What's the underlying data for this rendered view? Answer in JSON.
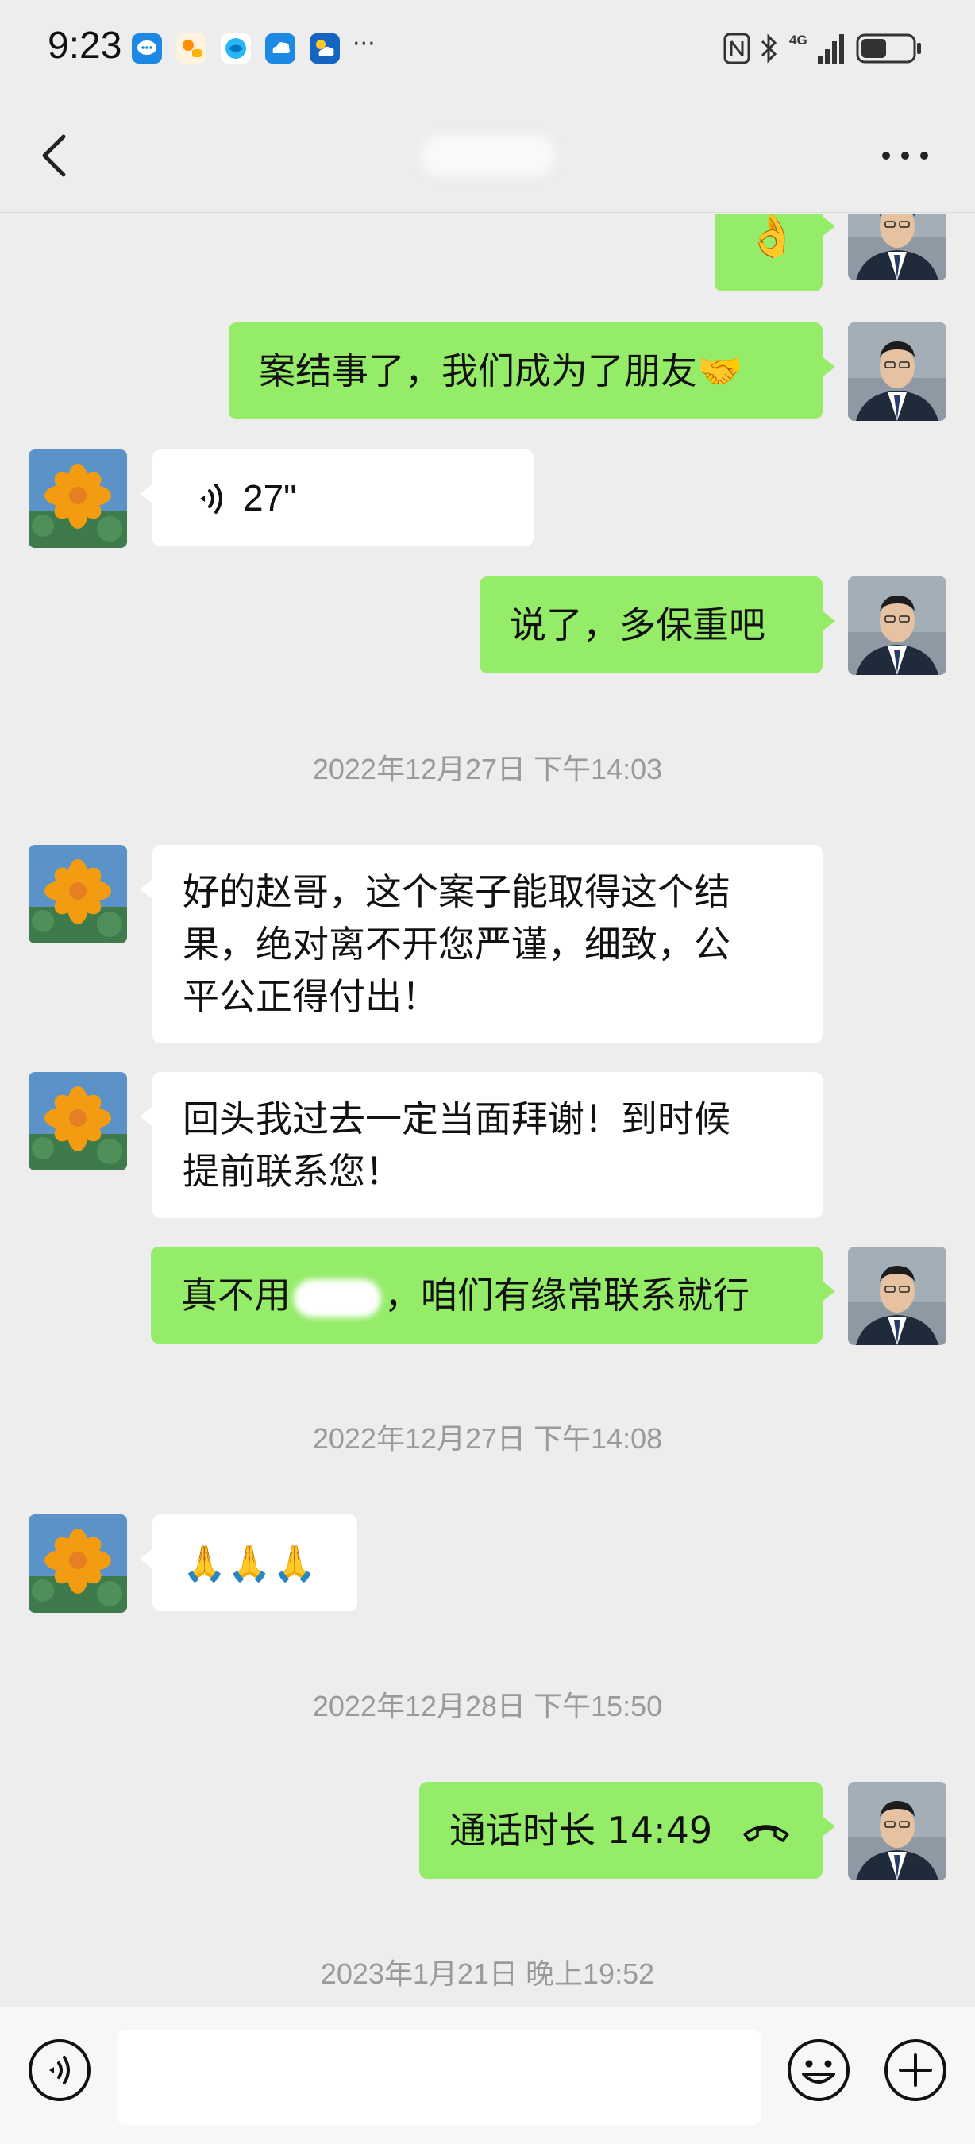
{
  "status_bar": {
    "time": "9:23",
    "notification_icons": [
      "message-icon",
      "cartoon-app-icon",
      "browser-icon",
      "cloud-icon",
      "weather-icon"
    ],
    "overflow": "···",
    "network": "4G",
    "battery_percent": 50
  },
  "header": {
    "back_icon": "chevron-left-icon",
    "title": "",
    "more_icon": "more-dots-icon"
  },
  "messages": [
    {
      "side": "me",
      "type": "emoji",
      "text": "👌"
    },
    {
      "side": "me",
      "type": "text",
      "text": "案结事了，我们成为了朋友🤝"
    },
    {
      "side": "other",
      "type": "voice",
      "duration": "27\""
    },
    {
      "side": "me",
      "type": "text",
      "text": "说了，多保重吧"
    },
    {
      "type": "timestamp",
      "text": "2022年12月27日 下午14:03"
    },
    {
      "side": "other",
      "type": "text",
      "lines": [
        "好的赵哥，这个案子能取得这个结",
        "果，绝对离不开您严谨，细致，公",
        "平公正得付出！"
      ]
    },
    {
      "side": "other",
      "type": "text",
      "lines": [
        "回头我过去一定当面拜谢！到时候",
        "提前联系您！"
      ]
    },
    {
      "side": "me",
      "type": "text",
      "text_before": "真不用",
      "text_after": "，咱们有缘常联系就行"
    },
    {
      "type": "timestamp",
      "text": "2022年12月27日 下午14:08"
    },
    {
      "side": "other",
      "type": "emoji",
      "text": "🙏🙏🙏"
    },
    {
      "type": "timestamp",
      "text": "2022年12月28日 下午15:50"
    },
    {
      "side": "me",
      "type": "call",
      "text": "通话时长 14:49"
    },
    {
      "type": "timestamp",
      "text": "2023年1月21日 晚上19:52"
    }
  ],
  "input_bar": {
    "voice_icon": "voice-input-icon",
    "emoji_icon": "emoji-icon",
    "plus_icon": "plus-icon",
    "value": ""
  },
  "colors": {
    "background": "#ededed",
    "my_bubble": "#95ec69",
    "other_bubble": "#ffffff",
    "timestamp": "#9a9a9a"
  }
}
